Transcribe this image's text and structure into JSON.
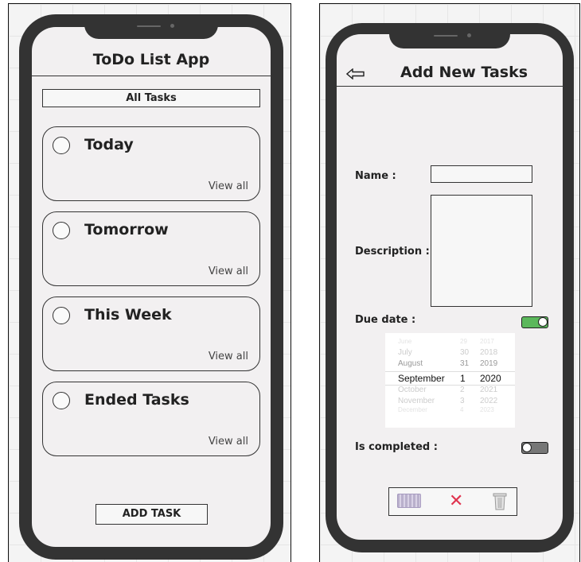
{
  "left_screen": {
    "title": "ToDo List App",
    "all_tasks_label": "All Tasks",
    "cards": [
      {
        "title": "Today",
        "link": "View all"
      },
      {
        "title": "Tomorrow",
        "link": "View all"
      },
      {
        "title": "This Week",
        "link": "View all"
      },
      {
        "title": "Ended Tasks",
        "link": "View all"
      }
    ],
    "add_task_label": "ADD TASK"
  },
  "right_screen": {
    "title": "Add New Tasks",
    "name_label": "Name :",
    "description_label": "Description :",
    "due_date_label": "Due date :",
    "due_date_enabled": true,
    "is_completed_label": "Is completed :",
    "is_completed": false,
    "date_picker": {
      "rows": [
        {
          "month": "June",
          "day": "29",
          "year": "2017"
        },
        {
          "month": "July",
          "day": "30",
          "year": "2018"
        },
        {
          "month": "August",
          "day": "31",
          "year": "2019"
        },
        {
          "month": "September",
          "day": "1",
          "year": "2020"
        },
        {
          "month": "October",
          "day": "2",
          "year": "2021"
        },
        {
          "month": "November",
          "day": "3",
          "year": "2022"
        },
        {
          "month": "December",
          "day": "4",
          "year": "2023"
        }
      ]
    },
    "actions": [
      "keyboard-icon",
      "close-icon",
      "trash-icon"
    ]
  },
  "colors": {
    "frame": "#333333",
    "screen_bg": "#f2f0f1",
    "toggle_on": "#5cb85c",
    "toggle_off": "#777777",
    "close": "#e0344f"
  }
}
